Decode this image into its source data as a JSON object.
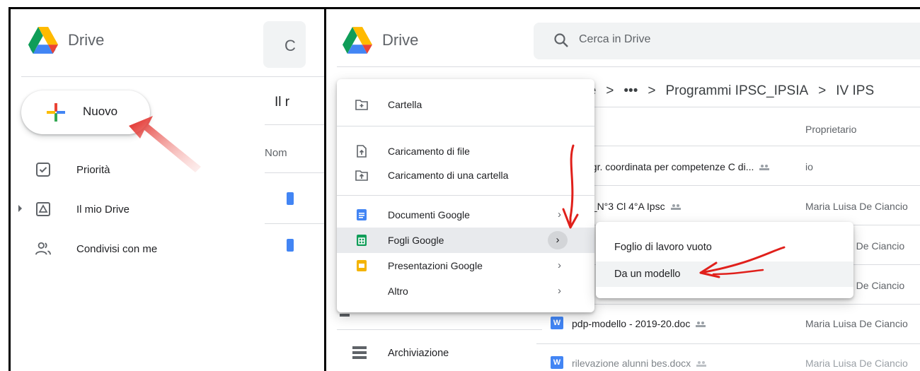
{
  "left": {
    "logo_text": "Drive",
    "search_glyph": "C",
    "new_button": "Nuovo",
    "nav": [
      {
        "label": "Priorità",
        "icon": "priority-check-icon"
      },
      {
        "label": "Il mio Drive",
        "icon": "my-drive-icon"
      },
      {
        "label": "Condivisi con me",
        "icon": "shared-people-icon"
      }
    ],
    "partial_heading": "Il r",
    "partial_column": "Nom"
  },
  "right": {
    "logo_text": "Drive",
    "search_placeholder": "Cerca in Drive",
    "breadcrumb": [
      "ive",
      ">",
      "•••",
      ">",
      "Programmi IPSC_IPSIA",
      ">",
      "IV IPS"
    ],
    "column_owner": "Proprietario",
    "rows": [
      {
        "name": "ogr. coordinata per competenze C di...",
        "owner": "io",
        "shared": true
      },
      {
        "name": "a_N°3 Cl 4°A Ipsc",
        "owner": "Maria Luisa De Ciancio",
        "shared": true
      },
      {
        "name": "",
        "owner": "a De Ciancio",
        "shared": false
      },
      {
        "name": "",
        "owner": "a De Ciancio",
        "shared": false
      },
      {
        "name": "pdp-modello - 2019-20.doc",
        "owner": "Maria Luisa De Ciancio",
        "shared": true
      },
      {
        "name": "rilevazione alunni bes.docx",
        "owner": "Maria Luisa De Ciancio",
        "shared": true
      }
    ],
    "sidebar_storage": "Archiviazione",
    "menu": {
      "items": [
        {
          "label": "Cartella",
          "icon": "folder-plus-icon"
        },
        {
          "label": "Caricamento di file",
          "icon": "file-upload-icon"
        },
        {
          "label": "Caricamento di una cartella",
          "icon": "folder-upload-icon"
        },
        {
          "label": "Documenti Google",
          "icon": "google-docs-icon",
          "has_submenu": true
        },
        {
          "label": "Fogli Google",
          "icon": "google-sheets-icon",
          "has_submenu": true,
          "active": true
        },
        {
          "label": "Presentazioni Google",
          "icon": "google-slides-icon",
          "has_submenu": true
        },
        {
          "label": "Altro",
          "icon": "",
          "has_submenu": true
        }
      ],
      "chevron": "›"
    },
    "submenu": [
      "Foglio di lavoro vuoto",
      "Da un modello"
    ]
  },
  "colors": {
    "docs_blue": "#4285f4",
    "sheets_green": "#0f9d58",
    "slides_yellow": "#f4b400",
    "annotation_red": "#e0201b"
  }
}
